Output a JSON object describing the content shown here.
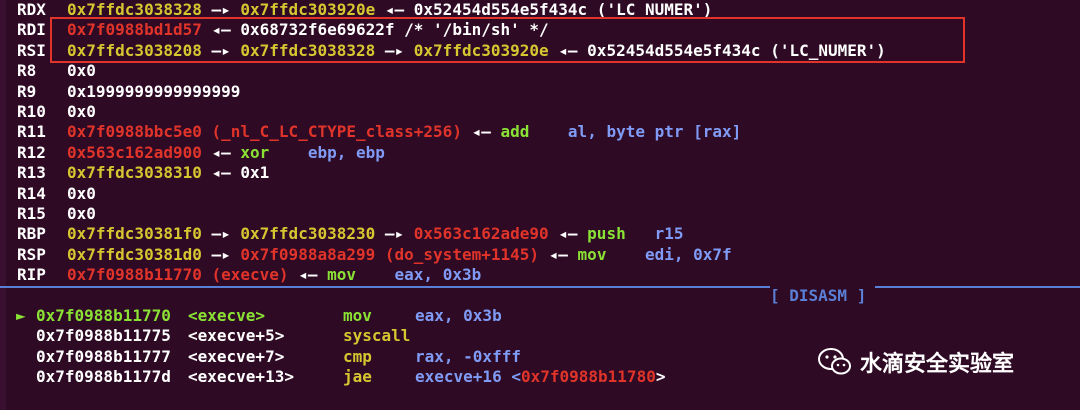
{
  "registers": [
    {
      "name": "RDX",
      "parts": [
        {
          "t": "0x7ffdc3038328",
          "c": "ylw"
        },
        {
          "t": " —▸ ",
          "c": "wht"
        },
        {
          "t": "0x7ffdc303920e",
          "c": "ylw"
        },
        {
          "t": " ◂— ",
          "c": "wht"
        },
        {
          "t": "0x52454d554e5f434c ('LC_NUMER')",
          "c": "wht"
        }
      ]
    },
    {
      "name": "RDI",
      "parts": [
        {
          "t": "0x7f0988bd1d57",
          "c": "red"
        },
        {
          "t": " ◂— ",
          "c": "wht"
        },
        {
          "t": "0x68732f6e69622f /* '/bin/sh' */",
          "c": "wht"
        }
      ]
    },
    {
      "name": "RSI",
      "parts": [
        {
          "t": "0x7ffdc3038208",
          "c": "ylw"
        },
        {
          "t": " —▸ ",
          "c": "wht"
        },
        {
          "t": "0x7ffdc3038328",
          "c": "ylw"
        },
        {
          "t": " —▸ ",
          "c": "wht"
        },
        {
          "t": "0x7ffdc303920e",
          "c": "ylw"
        },
        {
          "t": " ◂— ",
          "c": "wht"
        },
        {
          "t": "0x52454d554e5f434c ('LC_NUMER')",
          "c": "wht"
        }
      ]
    },
    {
      "name": "R8",
      "parts": [
        {
          "t": "0x0",
          "c": "wht"
        }
      ]
    },
    {
      "name": "R9",
      "parts": [
        {
          "t": "0x1999999999999999",
          "c": "wht"
        }
      ]
    },
    {
      "name": "R10",
      "parts": [
        {
          "t": "0x0",
          "c": "wht"
        }
      ]
    },
    {
      "name": "R11",
      "parts": [
        {
          "t": "0x7f0988bbc5e0 (_nl_C_LC_CTYPE_class+256)",
          "c": "red"
        },
        {
          "t": " ◂— ",
          "c": "wht"
        },
        {
          "t": "add",
          "c": "grn"
        },
        {
          "t": "    al, byte ptr [rax]",
          "c": "blu"
        }
      ]
    },
    {
      "name": "R12",
      "parts": [
        {
          "t": "0x563c162ad900",
          "c": "red"
        },
        {
          "t": " ◂— ",
          "c": "wht"
        },
        {
          "t": "xor",
          "c": "grn"
        },
        {
          "t": "    ebp, ebp",
          "c": "blu"
        }
      ]
    },
    {
      "name": "R13",
      "parts": [
        {
          "t": "0x7ffdc3038310",
          "c": "ylw"
        },
        {
          "t": " ◂— ",
          "c": "wht"
        },
        {
          "t": "0x1",
          "c": "wht"
        }
      ]
    },
    {
      "name": "R14",
      "parts": [
        {
          "t": "0x0",
          "c": "wht"
        }
      ]
    },
    {
      "name": "R15",
      "parts": [
        {
          "t": "0x0",
          "c": "wht"
        }
      ]
    },
    {
      "name": "RBP",
      "parts": [
        {
          "t": "0x7ffdc30381f0",
          "c": "ylw"
        },
        {
          "t": " —▸ ",
          "c": "wht"
        },
        {
          "t": "0x7ffdc3038230",
          "c": "ylw"
        },
        {
          "t": " —▸ ",
          "c": "wht"
        },
        {
          "t": "0x563c162ade90",
          "c": "red"
        },
        {
          "t": " ◂— ",
          "c": "wht"
        },
        {
          "t": "push",
          "c": "grn"
        },
        {
          "t": "   r15",
          "c": "blu"
        }
      ]
    },
    {
      "name": "RSP",
      "parts": [
        {
          "t": "0x7ffdc30381d0",
          "c": "ylw"
        },
        {
          "t": " —▸ ",
          "c": "wht"
        },
        {
          "t": "0x7f0988a8a299 (do_system+1145)",
          "c": "red"
        },
        {
          "t": " ◂— ",
          "c": "wht"
        },
        {
          "t": "mov",
          "c": "grn"
        },
        {
          "t": "    edi, 0x7f",
          "c": "blu"
        }
      ]
    },
    {
      "name": "RIP",
      "parts": [
        {
          "t": "0x7f0988b11770 (execve)",
          "c": "red"
        },
        {
          "t": " ◂— ",
          "c": "wht"
        },
        {
          "t": "mov",
          "c": "grn"
        },
        {
          "t": "    eax, 0x3b",
          "c": "blu"
        }
      ]
    }
  ],
  "disasm_label": "[ DISASM ]",
  "disasm": [
    {
      "arrow": "►",
      "addr": "0x7f0988b11770",
      "sym": "<execve>",
      "mn": "mov",
      "op": [
        {
          "t": "eax, 0x3b",
          "c": "blu"
        }
      ],
      "current": true
    },
    {
      "arrow": "",
      "addr": "0x7f0988b11775",
      "sym": "<execve+5>",
      "mn": "syscall",
      "op": [],
      "current": false
    },
    {
      "arrow": "",
      "addr": "0x7f0988b11777",
      "sym": "<execve+7>",
      "mn": "cmp",
      "op": [
        {
          "t": "rax, -0xfff",
          "c": "blu"
        }
      ],
      "current": false
    },
    {
      "arrow": "",
      "addr": "0x7f0988b1177d",
      "sym": "<execve+13>",
      "mn": "jae",
      "op": [
        {
          "t": "execve+16 <",
          "c": "blu"
        },
        {
          "t": "0x7f0988b11780",
          "c": "red"
        },
        {
          "t": ">",
          "c": "wht"
        }
      ],
      "current": false
    }
  ],
  "watermark": {
    "text": "水滴安全实验室",
    "icon": "wechat-icon"
  }
}
